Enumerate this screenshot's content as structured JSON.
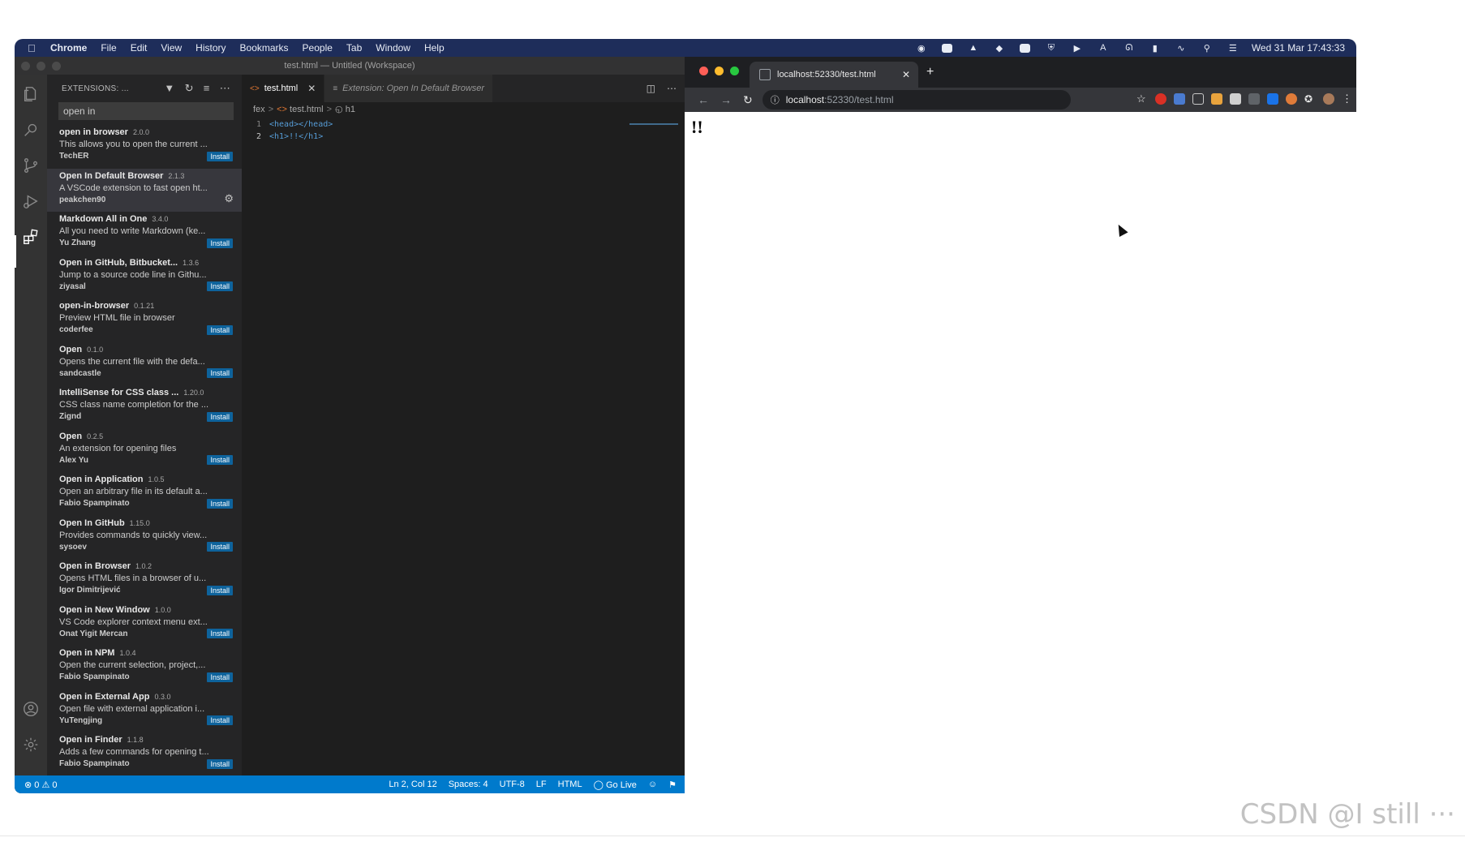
{
  "menubar": {
    "items": [
      "Chrome",
      "File",
      "Edit",
      "View",
      "History",
      "Bookmarks",
      "People",
      "Tab",
      "Window",
      "Help"
    ],
    "clock": "Wed 31 Mar  17:43:33"
  },
  "vscode": {
    "window_title": "test.html — Untitled (Workspace)",
    "sidebar": {
      "title": "EXTENSIONS: ...",
      "search_value": "open in",
      "extensions": [
        {
          "name": "open in browser",
          "version": "2.0.0",
          "desc": "This allows you to open the current ...",
          "author": "TechER",
          "action": "Install"
        },
        {
          "name": "Open In Default Browser",
          "version": "2.1.3",
          "desc": "A VSCode extension to fast open ht...",
          "author": "peakchen90",
          "action": ""
        },
        {
          "name": "Markdown All in One",
          "version": "3.4.0",
          "desc": "All you need to write Markdown (ke...",
          "author": "Yu Zhang",
          "action": "Install"
        },
        {
          "name": "Open in GitHub, Bitbucket...",
          "version": "1.3.6",
          "desc": "Jump to a source code line in Githu...",
          "author": "ziyasal",
          "action": "Install"
        },
        {
          "name": "open-in-browser",
          "version": "0.1.21",
          "desc": "Preview HTML file in browser",
          "author": "coderfee",
          "action": "Install"
        },
        {
          "name": "Open",
          "version": "0.1.0",
          "desc": "Opens the current file with the defa...",
          "author": "sandcastle",
          "action": "Install"
        },
        {
          "name": "IntelliSense for CSS class ...",
          "version": "1.20.0",
          "desc": "CSS class name completion for the ...",
          "author": "Zignd",
          "action": "Install"
        },
        {
          "name": "Open",
          "version": "0.2.5",
          "desc": "An extension for opening files",
          "author": "Alex Yu",
          "action": "Install"
        },
        {
          "name": "Open in Application",
          "version": "1.0.5",
          "desc": "Open an arbitrary file in its default a...",
          "author": "Fabio Spampinato",
          "action": "Install"
        },
        {
          "name": "Open In GitHub",
          "version": "1.15.0",
          "desc": "Provides commands to quickly view...",
          "author": "sysoev",
          "action": "Install"
        },
        {
          "name": "Open in Browser",
          "version": "1.0.2",
          "desc": "Opens HTML files in a browser of u...",
          "author": "Igor Dimitrijević",
          "action": "Install"
        },
        {
          "name": "Open in New Window",
          "version": "1.0.0",
          "desc": "VS Code explorer context menu ext...",
          "author": "Onat Yigit Mercan",
          "action": "Install"
        },
        {
          "name": "Open in NPM",
          "version": "1.0.4",
          "desc": "Open the current selection, project,...",
          "author": "Fabio Spampinato",
          "action": "Install"
        },
        {
          "name": "Open in External App",
          "version": "0.3.0",
          "desc": "Open file with external application i...",
          "author": "YuTengjing",
          "action": "Install"
        },
        {
          "name": "Open in Finder",
          "version": "1.1.8",
          "desc": "Adds a few commands for opening t...",
          "author": "Fabio Spampinato",
          "action": "Install"
        }
      ]
    },
    "tabs": [
      {
        "label": "test.html"
      },
      {
        "label": "Extension: Open In Default Browser"
      }
    ],
    "breadcrumb": [
      "fex",
      "test.html",
      "h1"
    ],
    "code_lines": [
      {
        "num": "1",
        "text": "<head></head>"
      },
      {
        "num": "2",
        "text": "<h1>!!</h1>"
      }
    ],
    "statusbar": {
      "problems": "⊗ 0 ⚠ 0",
      "position": "Ln 2, Col 12",
      "spaces": "Spaces: 4",
      "encoding": "UTF-8",
      "eol": "LF",
      "language": "HTML",
      "golive": "Go Live"
    }
  },
  "chrome": {
    "tab_title": "localhost:52330/test.html",
    "url_host": "localhost",
    "url_path": ":52330/test.html",
    "page_heading": "!!"
  },
  "watermark": "CSDN @I still ···",
  "colors": {
    "menubar": "#1e2d5a",
    "statusbar": "#007acc",
    "install_button": "#0e639c"
  }
}
